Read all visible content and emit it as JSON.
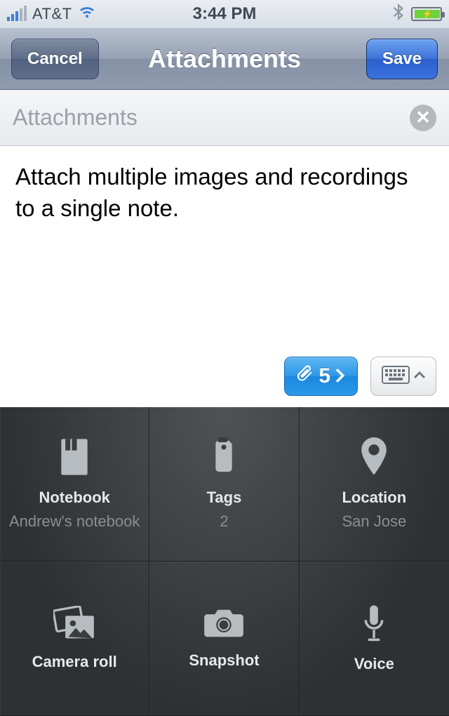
{
  "status": {
    "carrier": "AT&T",
    "time": "3:44 PM"
  },
  "nav": {
    "cancel": "Cancel",
    "title": "Attachments",
    "save": "Save"
  },
  "title_field": {
    "value": "Attachments"
  },
  "body_text": "Attach multiple images and recordings to a single note.",
  "toolbar": {
    "attach_count": "5"
  },
  "grid": {
    "notebook": {
      "title": "Notebook",
      "sub": "Andrew's notebook"
    },
    "tags": {
      "title": "Tags",
      "sub": "2"
    },
    "location": {
      "title": "Location",
      "sub": "San Jose"
    },
    "camera_roll": {
      "title": "Camera roll"
    },
    "snapshot": {
      "title": "Snapshot"
    },
    "voice": {
      "title": "Voice"
    }
  }
}
